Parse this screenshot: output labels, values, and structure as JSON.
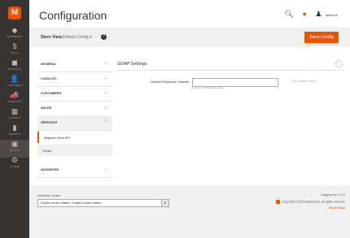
{
  "sidebar": {
    "items": [
      {
        "icon": "dashboard-icon",
        "glyph": "◆",
        "label": "Dashboard"
      },
      {
        "icon": "sales-icon",
        "glyph": "$",
        "label": "Sales"
      },
      {
        "icon": "catalog-icon",
        "glyph": "◼",
        "label": "Products"
      },
      {
        "icon": "customers-icon",
        "glyph": "👤",
        "label": "Customers"
      },
      {
        "icon": "marketing-icon",
        "glyph": "📣",
        "label": "Marketing"
      },
      {
        "icon": "content-icon",
        "glyph": "▦",
        "label": "Content"
      },
      {
        "icon": "reports-icon",
        "glyph": "▮",
        "label": "Reports"
      },
      {
        "icon": "stores-icon",
        "glyph": "▣",
        "label": "Stores"
      },
      {
        "icon": "system-icon",
        "glyph": "⚙",
        "label": "System"
      }
    ]
  },
  "header": {
    "title": "Configuration",
    "user_label": "admin ▾"
  },
  "toolbar": {
    "store_view_label": "Store View:",
    "store_view_value": "Default Config ▾",
    "save_label": "Save Config"
  },
  "tabs": {
    "general": "General",
    "catalog": "Catalog",
    "customers": "Customers",
    "sales": "Sales",
    "services": "Services",
    "services_items": [
      "Magento Web API",
      "OAuth"
    ],
    "advanced": "Advanced"
  },
  "section": {
    "title": "SOAP Settings",
    "field_label": "Default Response Charset",
    "field_value": "",
    "field_note": "If empty, UTF-8 will be used.",
    "use_system": "[Use system value]"
  },
  "footer": {
    "language_label": "Interface Locale",
    "language_value": "English (United States) / English (United States)",
    "magento_line": "Magento ver. 2.0.0",
    "copyright": "Copyright © 2015 Magento Inc. All rights reserved.",
    "report_bugs": "Report Bugs"
  },
  "colors": {
    "accent": "#eb5202",
    "sidebar": "#373330"
  }
}
